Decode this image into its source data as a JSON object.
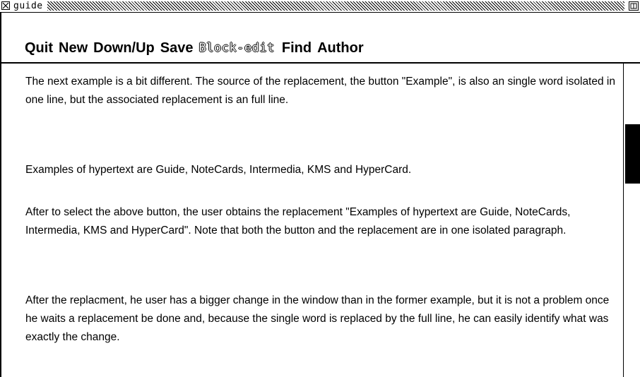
{
  "window": {
    "title": "guide",
    "close_icon": "close-box-icon",
    "zoom_icon": "zoom-box-icon"
  },
  "menu": {
    "items": [
      {
        "label": "Quit",
        "enabled": true
      },
      {
        "label": "New",
        "enabled": true
      },
      {
        "label": "Down/Up",
        "enabled": true
      },
      {
        "label": "Save",
        "enabled": true
      },
      {
        "label": "Block-edit",
        "enabled": false
      },
      {
        "label": "Find",
        "enabled": true
      },
      {
        "label": "Author",
        "enabled": true
      }
    ]
  },
  "document": {
    "paragraphs": [
      "The next example is a bit different. The source of the replacement, the button \"Example\", is also an single word isolated in one line, but the associated replacement is an full line.",
      "Examples of hypertext are Guide, NoteCards, Intermedia, KMS and HyperCard.",
      "After to select the above button, the user obtains the replacement \"Examples of hypertext are Guide, NoteCards, Intermedia, KMS and HyperCard\". Note that both the button and the replacement are in one isolated  paragraph.",
      "After the replacment, he user has a bigger change in the window than in the former example, but it is not a problem once he waits a replacement be done and,  because  the single word is replaced by the full line, he can easily identify what was exactly the change."
    ]
  },
  "scrollbar": {
    "thumb_position_fraction": 0.19
  }
}
